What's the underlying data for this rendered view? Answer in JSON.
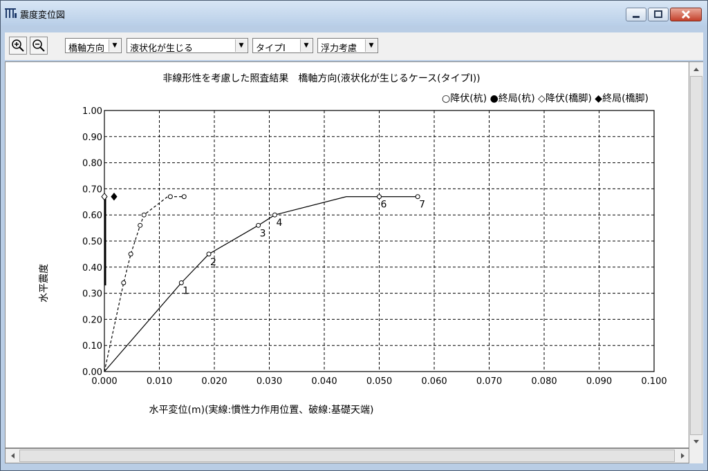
{
  "window": {
    "title": "震度変位図"
  },
  "toolbar": {
    "zoom_in_icon": "zoom-in-icon",
    "zoom_out_icon": "zoom-out-icon",
    "direction": "橋軸方向",
    "liquefaction": "液状化が生じる",
    "type": "タイプⅠ",
    "buoyancy": "浮力考慮"
  },
  "chart_data": {
    "type": "line",
    "title": "非線形性を考慮した照査結果　橋軸方向(液状化が生じるケース(タイプⅠ))",
    "legend": "○降伏(杭) ●終局(杭) ◇降伏(橋脚) ◆終局(橋脚)",
    "xlabel": "水平変位(m)(実線:慣性力作用位置、破線:基礎天端)",
    "ylabel": "水平震度",
    "xlim": [
      0,
      0.1
    ],
    "ylim": [
      0,
      1.0
    ],
    "xticks": [
      "0.000",
      "0.010",
      "0.020",
      "0.030",
      "0.040",
      "0.050",
      "0.060",
      "0.070",
      "0.080",
      "0.090",
      "0.100"
    ],
    "yticks": [
      "0.00",
      "0.10",
      "0.20",
      "0.30",
      "0.40",
      "0.50",
      "0.60",
      "0.70",
      "0.80",
      "0.90",
      "1.00"
    ],
    "grid": true,
    "series": [
      {
        "style": "solid",
        "points": [
          [
            0,
            0
          ],
          [
            0.014,
            0.34
          ],
          [
            0.019,
            0.45
          ],
          [
            0.028,
            0.56
          ],
          [
            0.031,
            0.6
          ],
          [
            0.044,
            0.67
          ],
          [
            0.05,
            0.67
          ],
          [
            0.057,
            0.67
          ]
        ]
      },
      {
        "style": "dashed",
        "points": [
          [
            0,
            0
          ],
          [
            0.0035,
            0.34
          ],
          [
            0.0048,
            0.45
          ],
          [
            0.0065,
            0.56
          ],
          [
            0.0072,
            0.6
          ],
          [
            0.0115,
            0.67
          ],
          [
            0.012,
            0.67
          ],
          [
            0.0145,
            0.67
          ]
        ]
      }
    ],
    "markers": [
      {
        "x": 0.014,
        "y": 0.34,
        "shape": "circle-open"
      },
      {
        "x": 0.019,
        "y": 0.45,
        "shape": "circle-open"
      },
      {
        "x": 0.028,
        "y": 0.56,
        "shape": "circle-open"
      },
      {
        "x": 0.031,
        "y": 0.6,
        "shape": "circle-open"
      },
      {
        "x": 0.05,
        "y": 0.67,
        "shape": "circle-open"
      },
      {
        "x": 0.057,
        "y": 0.67,
        "shape": "circle-open"
      },
      {
        "x": 0.0035,
        "y": 0.34,
        "shape": "circle-open"
      },
      {
        "x": 0.0048,
        "y": 0.45,
        "shape": "circle-open"
      },
      {
        "x": 0.0065,
        "y": 0.56,
        "shape": "circle-open"
      },
      {
        "x": 0.0072,
        "y": 0.6,
        "shape": "circle-open"
      },
      {
        "x": 0.012,
        "y": 0.67,
        "shape": "circle-open"
      },
      {
        "x": 0.0145,
        "y": 0.67,
        "shape": "circle-open"
      },
      {
        "x": 0.0,
        "y": 0.67,
        "shape": "diamond-open"
      },
      {
        "x": 0.001,
        "y": 0.67,
        "shape": "diamond-filled"
      }
    ],
    "point_labels": [
      {
        "text": "1",
        "x": 0.014,
        "y": 0.34
      },
      {
        "text": "2",
        "x": 0.019,
        "y": 0.45
      },
      {
        "text": "3",
        "x": 0.028,
        "y": 0.56
      },
      {
        "text": "4",
        "x": 0.031,
        "y": 0.6
      },
      {
        "text": "6",
        "x": 0.05,
        "y": 0.67
      },
      {
        "text": "7",
        "x": 0.057,
        "y": 0.67
      }
    ],
    "thick_segment": {
      "x": 0.0,
      "y_from": 0.33,
      "y_to": 0.67
    }
  }
}
